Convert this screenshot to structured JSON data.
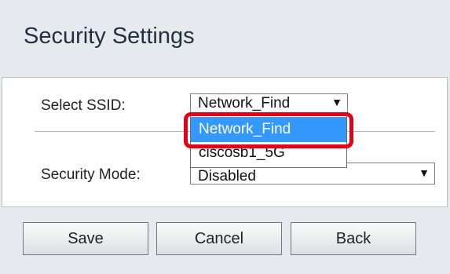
{
  "page": {
    "title": "Security Settings"
  },
  "form": {
    "ssid_label": "Select SSID:",
    "ssid_selected": "Network_Find",
    "ssid_options": [
      "Network_Find",
      "ciscosb1_5G"
    ],
    "security_mode_label": "Security Mode:",
    "security_mode_value": "Disabled"
  },
  "buttons": {
    "save": "Save",
    "cancel": "Cancel",
    "back": "Back"
  },
  "colors": {
    "highlight": "#e2001a",
    "selected_option_bg": "#3399ff",
    "title_text": "#243040"
  },
  "icons": {
    "dropdown_arrow": "▼"
  }
}
